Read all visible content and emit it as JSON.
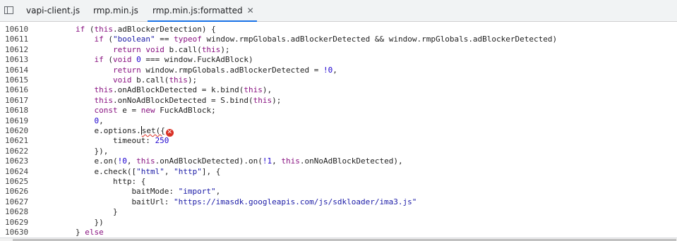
{
  "tabs": [
    {
      "label": "vapi-client.js",
      "active": false
    },
    {
      "label": "rmp.min.js",
      "active": false
    },
    {
      "label": "rmp.min.js:formatted",
      "active": true
    }
  ],
  "close_glyph": "✕",
  "error_glyph": "✕",
  "lines": [
    {
      "num": "10610",
      "indent": 8,
      "tokens": [
        {
          "t": "if",
          "c": "kw"
        },
        {
          "t": " (",
          "c": ""
        },
        {
          "t": "this",
          "c": "kw"
        },
        {
          "t": ".adBlockerDetection) {",
          "c": ""
        }
      ]
    },
    {
      "num": "10611",
      "indent": 12,
      "tokens": [
        {
          "t": "if",
          "c": "kw"
        },
        {
          "t": " (",
          "c": ""
        },
        {
          "t": "\"boolean\"",
          "c": "str"
        },
        {
          "t": " == ",
          "c": ""
        },
        {
          "t": "typeof",
          "c": "kw"
        },
        {
          "t": " window.rmpGlobals.adBlockerDetected && window.rmpGlobals.adBlockerDetected)",
          "c": ""
        }
      ]
    },
    {
      "num": "10612",
      "indent": 16,
      "tokens": [
        {
          "t": "return",
          "c": "kw"
        },
        {
          "t": " ",
          "c": ""
        },
        {
          "t": "void",
          "c": "kw"
        },
        {
          "t": " b.call(",
          "c": ""
        },
        {
          "t": "this",
          "c": "kw"
        },
        {
          "t": ");",
          "c": ""
        }
      ]
    },
    {
      "num": "10613",
      "indent": 12,
      "tokens": [
        {
          "t": "if",
          "c": "kw"
        },
        {
          "t": " (",
          "c": ""
        },
        {
          "t": "void",
          "c": "kw"
        },
        {
          "t": " ",
          "c": ""
        },
        {
          "t": "0",
          "c": "num"
        },
        {
          "t": " === window.FuckAdBlock)",
          "c": ""
        }
      ]
    },
    {
      "num": "10614",
      "indent": 16,
      "tokens": [
        {
          "t": "return",
          "c": "kw"
        },
        {
          "t": " window.rmpGlobals.adBlockerDetected = ",
          "c": ""
        },
        {
          "t": "!0",
          "c": "num"
        },
        {
          "t": ",",
          "c": ""
        }
      ]
    },
    {
      "num": "10615",
      "indent": 16,
      "tokens": [
        {
          "t": "void",
          "c": "kw"
        },
        {
          "t": " b.call(",
          "c": ""
        },
        {
          "t": "this",
          "c": "kw"
        },
        {
          "t": ");",
          "c": ""
        }
      ]
    },
    {
      "num": "10616",
      "indent": 12,
      "tokens": [
        {
          "t": "this",
          "c": "kw"
        },
        {
          "t": ".onAdBlockDetected = k.bind(",
          "c": ""
        },
        {
          "t": "this",
          "c": "kw"
        },
        {
          "t": "),",
          "c": ""
        }
      ]
    },
    {
      "num": "10617",
      "indent": 12,
      "tokens": [
        {
          "t": "this",
          "c": "kw"
        },
        {
          "t": ".onNoAdBlockDetected = S.bind(",
          "c": ""
        },
        {
          "t": "this",
          "c": "kw"
        },
        {
          "t": ");",
          "c": ""
        }
      ]
    },
    {
      "num": "10618",
      "indent": 12,
      "tokens": [
        {
          "t": "const",
          "c": "kw"
        },
        {
          "t": " e = ",
          "c": ""
        },
        {
          "t": "new",
          "c": "kw"
        },
        {
          "t": " FuckAdBlock;",
          "c": ""
        }
      ]
    },
    {
      "num": "10619",
      "indent": 12,
      "tokens": [
        {
          "t": "0",
          "c": "num"
        },
        {
          "t": ",",
          "c": ""
        }
      ]
    },
    {
      "num": "10620",
      "indent": 12,
      "tokens": [
        {
          "t": "e.options.",
          "c": ""
        },
        {
          "t": "CURSOR",
          "c": "cursor"
        },
        {
          "t": "set({",
          "c": "squiggle"
        },
        {
          "t": "ERR",
          "c": "err"
        }
      ]
    },
    {
      "num": "10621",
      "indent": 16,
      "tokens": [
        {
          "t": "timeout: ",
          "c": ""
        },
        {
          "t": "250",
          "c": "num"
        }
      ]
    },
    {
      "num": "10622",
      "indent": 12,
      "tokens": [
        {
          "t": "}),",
          "c": ""
        }
      ]
    },
    {
      "num": "10623",
      "indent": 12,
      "tokens": [
        {
          "t": "e.on(",
          "c": ""
        },
        {
          "t": "!0",
          "c": "num"
        },
        {
          "t": ", ",
          "c": ""
        },
        {
          "t": "this",
          "c": "kw"
        },
        {
          "t": ".onAdBlockDetected).on(",
          "c": ""
        },
        {
          "t": "!1",
          "c": "num"
        },
        {
          "t": ", ",
          "c": ""
        },
        {
          "t": "this",
          "c": "kw"
        },
        {
          "t": ".onNoAdBlockDetected),",
          "c": ""
        }
      ]
    },
    {
      "num": "10624",
      "indent": 12,
      "tokens": [
        {
          "t": "e.check([",
          "c": ""
        },
        {
          "t": "\"html\"",
          "c": "str"
        },
        {
          "t": ", ",
          "c": ""
        },
        {
          "t": "\"http\"",
          "c": "str"
        },
        {
          "t": "], {",
          "c": ""
        }
      ]
    },
    {
      "num": "10625",
      "indent": 16,
      "tokens": [
        {
          "t": "http: {",
          "c": ""
        }
      ]
    },
    {
      "num": "10626",
      "indent": 20,
      "tokens": [
        {
          "t": "baitMode: ",
          "c": ""
        },
        {
          "t": "\"import\"",
          "c": "str"
        },
        {
          "t": ",",
          "c": ""
        }
      ]
    },
    {
      "num": "10627",
      "indent": 20,
      "tokens": [
        {
          "t": "baitUrl: ",
          "c": ""
        },
        {
          "t": "\"https://imasdk.googleapis.com/js/sdkloader/ima3.js\"",
          "c": "str"
        }
      ]
    },
    {
      "num": "10628",
      "indent": 16,
      "tokens": [
        {
          "t": "}",
          "c": ""
        }
      ]
    },
    {
      "num": "10629",
      "indent": 12,
      "tokens": [
        {
          "t": "})",
          "c": ""
        }
      ]
    },
    {
      "num": "10630",
      "indent": 8,
      "tokens": [
        {
          "t": "} ",
          "c": ""
        },
        {
          "t": "else",
          "c": "kw"
        }
      ]
    }
  ]
}
